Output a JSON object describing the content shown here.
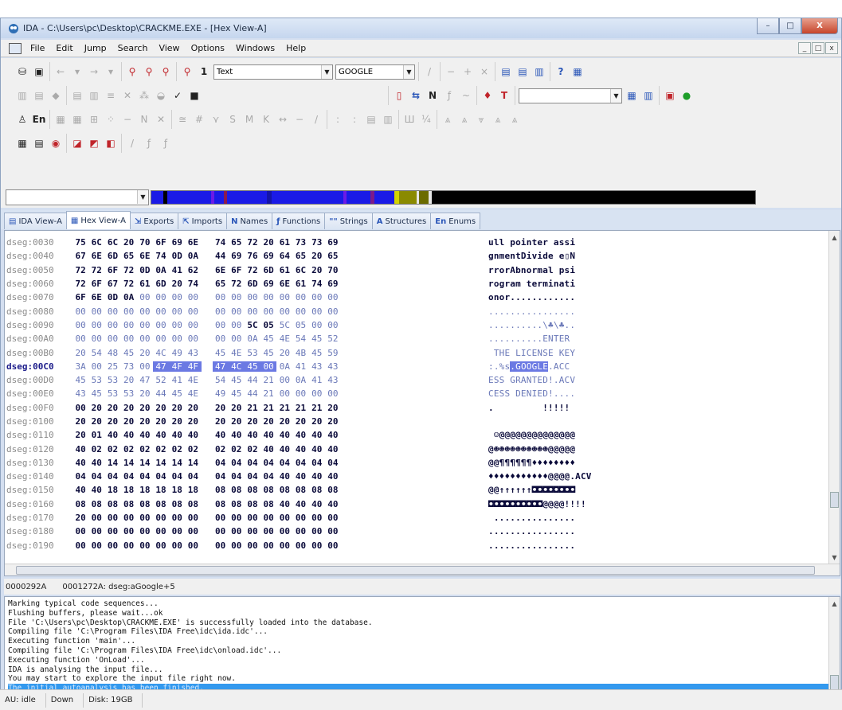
{
  "window": {
    "title": "IDA - C:\\Users\\pc\\Desktop\\CRACKME.EXE - [Hex View-A]",
    "controls": [
      "–",
      "□",
      "X"
    ]
  },
  "menu": {
    "items": [
      "File",
      "Edit",
      "Jump",
      "Search",
      "View",
      "Options",
      "Windows",
      "Help"
    ],
    "mdi_controls": [
      "_",
      "□",
      "x"
    ]
  },
  "toolbar": {
    "type_combo": "Text",
    "search_combo": "GOOGLE",
    "empty_combo": "",
    "nav_combo": ""
  },
  "tabs": [
    {
      "label": "IDA View-A",
      "icon": "ida-view-icon",
      "glyph": "▤"
    },
    {
      "label": "Hex View-A",
      "icon": "hex-view-icon",
      "glyph": "▦"
    },
    {
      "label": "Exports",
      "icon": "exports-icon",
      "glyph": "⇲"
    },
    {
      "label": "Imports",
      "icon": "imports-icon",
      "glyph": "⇱"
    },
    {
      "label": "Names",
      "icon": "names-icon",
      "glyph": "N"
    },
    {
      "label": "Functions",
      "icon": "functions-icon",
      "glyph": "ƒ"
    },
    {
      "label": "Strings",
      "icon": "strings-icon",
      "glyph": "\"\""
    },
    {
      "label": "Structures",
      "icon": "structures-icon",
      "glyph": "A"
    },
    {
      "label": "Enums",
      "icon": "enums-icon",
      "glyph": "En"
    }
  ],
  "hex_view": {
    "rows": [
      {
        "addr": "dseg:0030",
        "bytes": [
          "75",
          "6C",
          "6C",
          "20",
          "70",
          "6F",
          "69",
          "6E",
          "74",
          "65",
          "72",
          "20",
          "61",
          "73",
          "73",
          "69"
        ],
        "ascii": "ull pointer assi"
      },
      {
        "addr": "dseg:0040",
        "bytes": [
          "67",
          "6E",
          "6D",
          "65",
          "6E",
          "74",
          "0D",
          "0A",
          "44",
          "69",
          "76",
          "69",
          "64",
          "65",
          "20",
          "65"
        ],
        "ascii": "gnmentDivide e▯N"
      },
      {
        "addr": "dseg:0050",
        "bytes": [
          "72",
          "72",
          "6F",
          "72",
          "0D",
          "0A",
          "41",
          "62",
          "6E",
          "6F",
          "72",
          "6D",
          "61",
          "6C",
          "20",
          "70"
        ],
        "ascii": "rrorAbnormal psi"
      },
      {
        "addr": "dseg:0060",
        "bytes": [
          "72",
          "6F",
          "67",
          "72",
          "61",
          "6D",
          "20",
          "74",
          "65",
          "72",
          "6D",
          "69",
          "6E",
          "61",
          "74",
          "69"
        ],
        "ascii": "rogram terminati"
      },
      {
        "addr": "dseg:0070",
        "bytes": [
          "6F",
          "6E",
          "0D",
          "0A",
          "00",
          "00",
          "00",
          "00",
          "00",
          "00",
          "00",
          "00",
          "00",
          "00",
          "00",
          "00"
        ],
        "ascii": "onor............"
      },
      {
        "addr": "dseg:0080",
        "bytes": [
          "00",
          "00",
          "00",
          "00",
          "00",
          "00",
          "00",
          "00",
          "00",
          "00",
          "00",
          "00",
          "00",
          "00",
          "00",
          "00"
        ],
        "ascii": "................"
      },
      {
        "addr": "dseg:0090",
        "bytes": [
          "00",
          "00",
          "00",
          "00",
          "00",
          "00",
          "00",
          "00",
          "00",
          "00",
          "5C",
          "05",
          "5C",
          "05",
          "00",
          "00"
        ],
        "ascii": "..........\\♣\\♣.."
      },
      {
        "addr": "dseg:00A0",
        "bytes": [
          "00",
          "00",
          "00",
          "00",
          "00",
          "00",
          "00",
          "00",
          "00",
          "00",
          "0A",
          "45",
          "4E",
          "54",
          "45",
          "52"
        ],
        "ascii": "..........ENTER"
      },
      {
        "addr": "dseg:00B0",
        "bytes": [
          "20",
          "54",
          "48",
          "45",
          "20",
          "4C",
          "49",
          "43",
          "45",
          "4E",
          "53",
          "45",
          "20",
          "4B",
          "45",
          "59"
        ],
        "ascii": " THE LICENSE KEY"
      },
      {
        "addr": "dseg:00C0",
        "bytes": [
          "3A",
          "00",
          "25",
          "73",
          "00",
          "47",
          "4F",
          "4F",
          "47",
          "4C",
          "45",
          "00",
          "0A",
          "41",
          "43",
          "43"
        ],
        "ascii": ":.%s.GOOGLE.ACC"
      },
      {
        "addr": "dseg:00D0",
        "bytes": [
          "45",
          "53",
          "53",
          "20",
          "47",
          "52",
          "41",
          "4E",
          "54",
          "45",
          "44",
          "21",
          "00",
          "0A",
          "41",
          "43"
        ],
        "ascii": "ESS GRANTED!.ACV"
      },
      {
        "addr": "dseg:00E0",
        "bytes": [
          "43",
          "45",
          "53",
          "53",
          "20",
          "44",
          "45",
          "4E",
          "49",
          "45",
          "44",
          "21",
          "00",
          "00",
          "00",
          "00"
        ],
        "ascii": "CESS DENIED!...."
      },
      {
        "addr": "dseg:00F0",
        "bytes": [
          "00",
          "20",
          "20",
          "20",
          "20",
          "20",
          "20",
          "20",
          "20",
          "20",
          "21",
          "21",
          "21",
          "21",
          "21",
          "20"
        ],
        "ascii": ".         !!!!! "
      },
      {
        "addr": "dseg:0100",
        "bytes": [
          "20",
          "20",
          "20",
          "20",
          "20",
          "20",
          "20",
          "20",
          "20",
          "20",
          "20",
          "20",
          "20",
          "20",
          "20",
          "20"
        ],
        "ascii": "                "
      },
      {
        "addr": "dseg:0110",
        "bytes": [
          "20",
          "01",
          "40",
          "40",
          "40",
          "40",
          "40",
          "40",
          "40",
          "40",
          "40",
          "40",
          "40",
          "40",
          "40",
          "40"
        ],
        "ascii": " ☺@@@@@@@@@@@@@@"
      },
      {
        "addr": "dseg:0120",
        "bytes": [
          "40",
          "02",
          "02",
          "02",
          "02",
          "02",
          "02",
          "02",
          "02",
          "02",
          "02",
          "40",
          "40",
          "40",
          "40",
          "40"
        ],
        "ascii": "@☻☻☻☻☻☻☻☻☻☻@@@@@"
      },
      {
        "addr": "dseg:0130",
        "bytes": [
          "40",
          "40",
          "14",
          "14",
          "14",
          "14",
          "14",
          "14",
          "04",
          "04",
          "04",
          "04",
          "04",
          "04",
          "04",
          "04"
        ],
        "ascii": "@@¶¶¶¶¶¶♦♦♦♦♦♦♦♦"
      },
      {
        "addr": "dseg:0140",
        "bytes": [
          "04",
          "04",
          "04",
          "04",
          "04",
          "04",
          "04",
          "04",
          "04",
          "04",
          "04",
          "04",
          "40",
          "40",
          "40",
          "40"
        ],
        "ascii": "♦♦♦♦♦♦♦♦♦♦♦@@@@.ACV"
      },
      {
        "addr": "dseg:0150",
        "bytes": [
          "40",
          "40",
          "18",
          "18",
          "18",
          "18",
          "18",
          "18",
          "08",
          "08",
          "08",
          "08",
          "08",
          "08",
          "08",
          "08"
        ],
        "ascii": "@@↑↑↑↑↑↑◘◘◘◘◘◘◘◘"
      },
      {
        "addr": "dseg:0160",
        "bytes": [
          "08",
          "08",
          "08",
          "08",
          "08",
          "08",
          "08",
          "08",
          "08",
          "08",
          "08",
          "08",
          "40",
          "40",
          "40",
          "40"
        ],
        "ascii": "◘◘◘◘◘◘◘◘◘◘@@@@!!!!"
      },
      {
        "addr": "dseg:0170",
        "bytes": [
          "20",
          "00",
          "00",
          "00",
          "00",
          "00",
          "00",
          "00",
          "00",
          "00",
          "00",
          "00",
          "00",
          "00",
          "00",
          "00"
        ],
        "ascii": " ..............."
      },
      {
        "addr": "dseg:0180",
        "bytes": [
          "00",
          "00",
          "00",
          "00",
          "00",
          "00",
          "00",
          "00",
          "00",
          "00",
          "00",
          "00",
          "00",
          "00",
          "00",
          "00"
        ],
        "ascii": "................"
      },
      {
        "addr": "dseg:0190",
        "bytes": [
          "00",
          "00",
          "00",
          "00",
          "00",
          "00",
          "00",
          "00",
          "00",
          "00",
          "00",
          "00",
          "00",
          "00",
          "00",
          "00"
        ],
        "ascii": "................"
      }
    ]
  },
  "status_line": {
    "offset": "0000292A",
    "location": "0001272A: dseg:aGoogle+5"
  },
  "output": {
    "lines": [
      "Marking typical code sequences...",
      "Flushing buffers, please wait...ok",
      "File 'C:\\Users\\pc\\Desktop\\CRACKME.EXE' is successfully loaded into the database.",
      "Compiling file 'C:\\Program Files\\IDA Free\\idc\\ida.idc'...",
      "Executing function 'main'...",
      "Compiling file 'C:\\Program Files\\IDA Free\\idc\\onload.idc'...",
      "Executing function 'OnLoad'...",
      "IDA is analysing the input file...",
      "You may start to explore the input file right now.",
      "The initial autoanalysis has been finished."
    ]
  },
  "bottom_status": {
    "au": "AU: idle",
    "direction": "Down",
    "disk": "Disk: 19GB"
  },
  "colors": {
    "selection": "#6b79e3",
    "output_highlight": "#3399ee",
    "chrome": "#d4dff0"
  }
}
